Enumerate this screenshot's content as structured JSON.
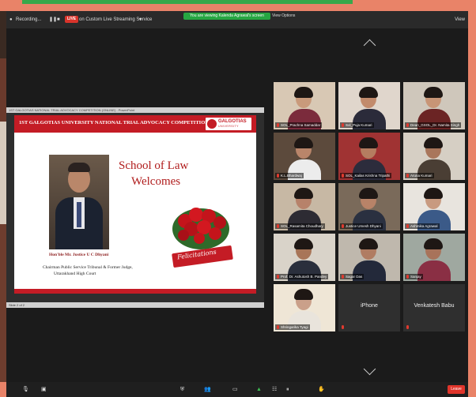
{
  "topbar": {
    "recording_label": "Recording...",
    "live_badge": "LIVE",
    "stream_label": "on Custom Live Streaming Service",
    "speaker_banner": "You are viewing Kalenda Agrawal's screen",
    "view_options": "View Options",
    "view_button": "View"
  },
  "slide": {
    "window_title": "1ST GALGOTIAS NATIONAL TRIAL ADVOCACY COMPETITION (ONLINE) - PowerPoint",
    "heading": "1ST GALGOTIAS UNIVERSITY NATIONAL TRIAL ADVOCACY COMPETITION (ONLINE)",
    "logo_name": "GALGOTIAS",
    "logo_sub": "UNIVERSITY",
    "welcome_line1": "School of Law",
    "welcome_line2": "Welcomes",
    "guest_name": "Hon'ble Mr. Justice U C Dhyani",
    "designation_line1": "Chairman Public Service Tribunal & Former Judge,",
    "designation_line2": "Uttarakhand High Court",
    "ribbon_text": "Felicitations",
    "status": "Slide 2 of 2"
  },
  "participants": [
    {
      "name": "SOL_Prachna Samaddar",
      "skin": "#c99a7b",
      "bg": "#d8c8b4",
      "shirt": "#7b2b3c",
      "active": true
    },
    {
      "name": "Sol_Puja Kumari",
      "skin": "#c28b6c",
      "bg": "#e0d6cc",
      "shirt": "#2b2b3a",
      "active": false
    },
    {
      "name": "Dean_GSOL_Dr. Namita Singh",
      "skin": "#c89576",
      "bg": "#cfc7bb",
      "shirt": "#6b2424",
      "active": false
    },
    {
      "name": "K.L.Bhardwaj",
      "skin": "#b9856a",
      "bg": "#5c4a3c",
      "shirt": "#ececec",
      "active": false
    },
    {
      "name": "SOL_Kailas Krishna Tripathi",
      "skin": "#b57d60",
      "bg": "#a03333",
      "shirt": "#2c2c3c",
      "active": false
    },
    {
      "name": "Aruna Kumari",
      "skin": "#a9765b",
      "bg": "#d6cfc4",
      "shirt": "#4a3e34",
      "active": false
    },
    {
      "name": "SOL_Rasamita Choudhary",
      "skin": "#b7826a",
      "bg": "#c7b8a4",
      "shirt": "#2d2b33",
      "active": false
    },
    {
      "name": "Justice Umesh Dhyani",
      "skin": "#b88368",
      "bg": "#7a6a5a",
      "shirt": "#2a3040",
      "active": false
    },
    {
      "name": "Ashmika Agrawal",
      "skin": "#c89a80",
      "bg": "#e8e4de",
      "shirt": "#3b5a88",
      "active": false
    },
    {
      "name": "Prof. Dr. Ashutosh B. Pandey",
      "skin": "#a87558",
      "bg": "#d9d3c9",
      "shirt": "#2a2f3c",
      "active": false
    },
    {
      "name": "Sagar Das",
      "skin": "#b07c62",
      "bg": "#bfb8ad",
      "shirt": "#23293a",
      "active": false
    },
    {
      "name": "Sanjay",
      "skin": "#a8735a",
      "bg": "#9fa8a0",
      "shirt": "#8a2f44",
      "active": false
    },
    {
      "name": "Shringarika Tyagi",
      "skin": "#caa08a",
      "bg": "#efe6d6",
      "shirt": "#e9e4dc",
      "active": false
    },
    {
      "name": "iPhone",
      "big": true,
      "active": false
    },
    {
      "name": "Venkatesh Babu",
      "big": true,
      "active": false
    }
  ],
  "bottombar": {
    "leave_label": "Leave"
  },
  "colors": {
    "accent_red": "#c41c25",
    "active_speaker": "#d8df3a",
    "live_red": "#d9342b",
    "banner_green": "#26a642"
  }
}
